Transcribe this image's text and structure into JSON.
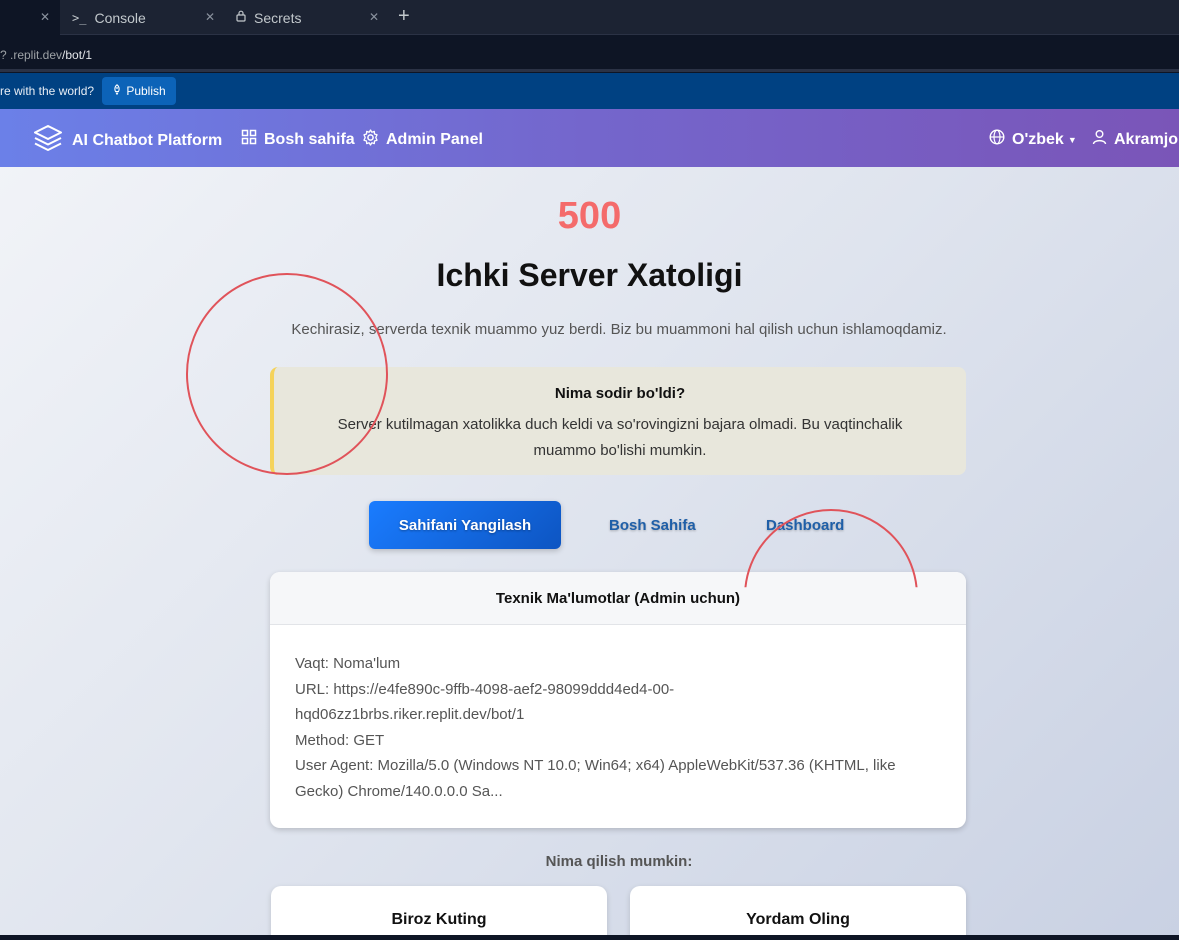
{
  "tabs": [
    {
      "label": ""
    },
    {
      "label": "Console",
      "icon": "console-icon"
    },
    {
      "label": "Secrets",
      "icon": "lock-icon"
    }
  ],
  "url": {
    "prefix": "? .replit.dev",
    "path": "/bot/1"
  },
  "banner": {
    "text": "re with the world?",
    "publish_label": "Publish"
  },
  "navbar": {
    "brand": "AI Chatbot Platform",
    "home": "Bosh sahifa",
    "admin": "Admin Panel",
    "language": "O'zbek",
    "user": "Akramjon"
  },
  "error": {
    "code": "500",
    "title": "Ichki Server Xatoligi",
    "subtitle": "Kechirasiz, serverda texnik muammo yuz berdi. Biz bu muammoni hal qilish uchun ishlamoqdamiz."
  },
  "alert": {
    "heading": "Nima sodir bo'ldi?",
    "text": "Server kutilmagan xatolikka duch keldi va so'rovingizni bajara olmadi. Bu vaqtinchalik muammo bo'lishi mumkin."
  },
  "actions": {
    "refresh": "Sahifani Yangilash",
    "home": "Bosh Sahifa",
    "dashboard": "Dashboard"
  },
  "tech": {
    "heading": "Texnik Ma'lumotlar (Admin uchun)",
    "time": "Vaqt: Noma'lum",
    "url_line1": "URL: https://e4fe890c-9ffb-4098-aef2-98099ddd4ed4-00-",
    "url_line2": "hqd06zz1brbs.riker.replit.dev/bot/1",
    "method": "Method: GET",
    "agent_line1": "User Agent: Mozilla/5.0 (Windows NT 10.0; Win64; x64) AppleWebKit/537.36 (KHTML, like",
    "agent_line2": "Gecko) Chrome/140.0.0.0 Sa..."
  },
  "what_to_do": {
    "heading": "Nima qilish mumkin:",
    "cards": [
      "Biroz Kuting",
      "Yordam Oling"
    ]
  },
  "colors": {
    "error_code": "#f46b6b",
    "primary": "#1a7cff",
    "alert_border": "#f5d35a",
    "annotation": "#e0535a"
  }
}
